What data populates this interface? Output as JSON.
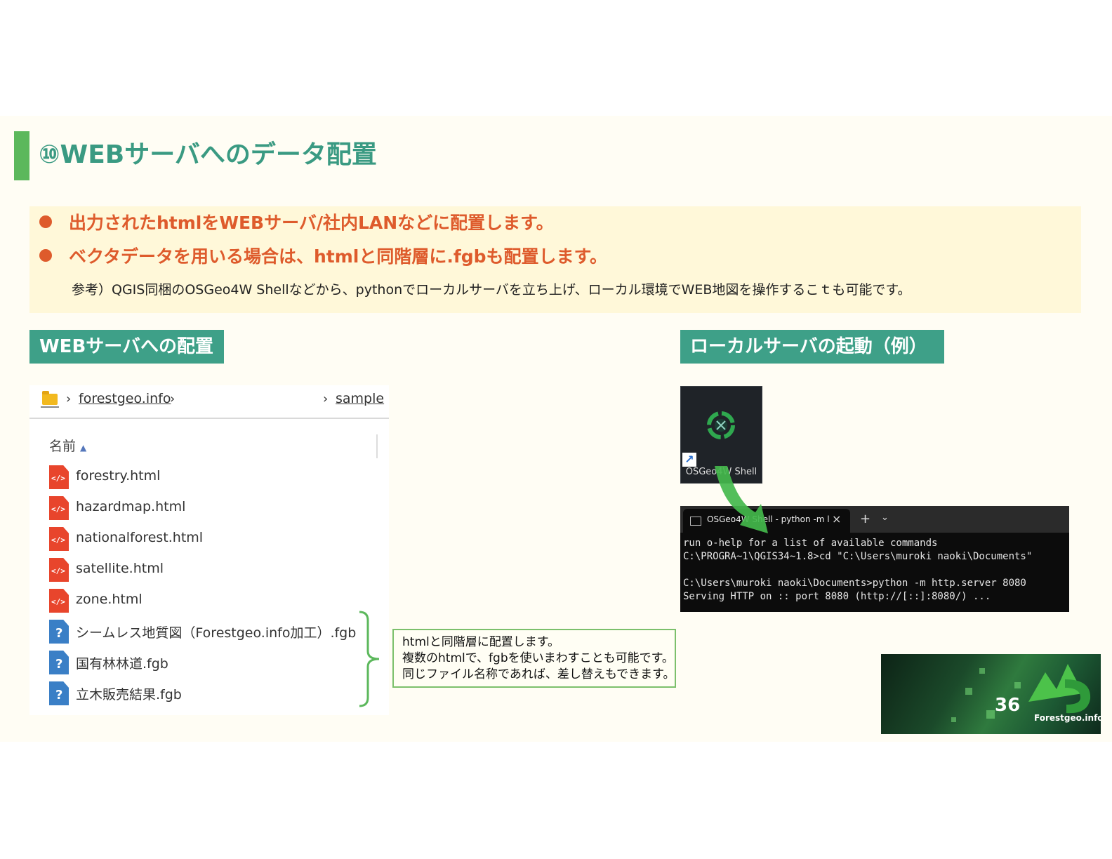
{
  "title": "⑩WEBサーバへのデータ配置",
  "bullets": [
    "出力されたhtmlをWEBサーバ/社内LANなどに配置します。",
    "ベクタデータを用いる場合は、htmlと同階層に.fgbも配置します。"
  ],
  "note": "参考）QGIS同梱のOSGeo4W Shellなどから、pythonでローカルサーバを立ち上げ、ローカル環境でWEB地図を操作するこｔも可能です。",
  "left_section": {
    "heading": "WEBサーバへの配置",
    "breadcrumb": {
      "first": "forestgeo.info",
      "second": "sample"
    },
    "column_header": "名前",
    "files": [
      {
        "name": "forestry.html",
        "type": "html"
      },
      {
        "name": "hazardmap.html",
        "type": "html"
      },
      {
        "name": "nationalforest.html",
        "type": "html"
      },
      {
        "name": "satellite.html",
        "type": "html"
      },
      {
        "name": "zone.html",
        "type": "html"
      },
      {
        "name": "シームレス地質図（Forestgeo.info加工）.fgb",
        "type": "unknown"
      },
      {
        "name": "国有林林道.fgb",
        "type": "unknown"
      },
      {
        "name": "立木販売結果.fgb",
        "type": "unknown"
      }
    ],
    "callout": [
      "htmlと同階層に配置します。",
      "複数のhtmlで、fgbを使いまわすことも可能です。",
      "同じファイル名称であれば、差し替えもできます。"
    ]
  },
  "right_section": {
    "heading": "ローカルサーバの起動（例）",
    "shortcut_label": "OSGeo4W Shell",
    "terminal": {
      "tab_title": "OSGeo4W Shell - python -m l",
      "lines": [
        "run o-help for a list of available commands",
        "C:\\PROGRA~1\\QGIS34~1.8>cd \"C:\\Users\\muroki naoki\\Documents\"",
        "",
        "C:\\Users\\muroki naoki\\Documents>python -m http.server 8080",
        "Serving HTTP on :: port 8080 (http://[::]:8080/) ..."
      ]
    }
  },
  "page_number": "36",
  "brand": "Forestgeo.info",
  "colors": {
    "accent_green": "#3ea088",
    "bullet_orange": "#de5b2c",
    "title_teal": "#3a9a82"
  }
}
